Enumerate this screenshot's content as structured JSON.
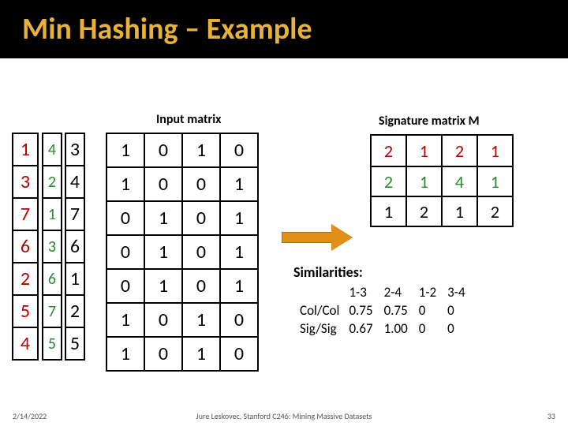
{
  "title": "Min Hashing – Example",
  "labels": {
    "input": "Input matrix",
    "signature": "Signature matrix M"
  },
  "perm": {
    "col0": [
      "1",
      "3",
      "7",
      "6",
      "2",
      "5",
      "4"
    ],
    "col1": [
      "4",
      "2",
      "1",
      "3",
      "6",
      "7",
      "5"
    ],
    "col2": [
      "3",
      "4",
      "7",
      "6",
      "1",
      "2",
      "5"
    ]
  },
  "input_matrix": [
    [
      "1",
      "0",
      "1",
      "0"
    ],
    [
      "1",
      "0",
      "0",
      "1"
    ],
    [
      "0",
      "1",
      "0",
      "1"
    ],
    [
      "0",
      "1",
      "0",
      "1"
    ],
    [
      "0",
      "1",
      "0",
      "1"
    ],
    [
      "1",
      "0",
      "1",
      "0"
    ],
    [
      "1",
      "0",
      "1",
      "0"
    ]
  ],
  "sig_matrix": [
    [
      "2",
      "1",
      "2",
      "1"
    ],
    [
      "2",
      "1",
      "4",
      "1"
    ],
    [
      "1",
      "2",
      "1",
      "2"
    ]
  ],
  "sim": {
    "title": "Similarities:",
    "hdr": [
      "1-3",
      "2-4",
      "1-2",
      "3-4"
    ],
    "rows": [
      {
        "label": "Col/Col",
        "vals": [
          "0.75",
          "0.75",
          "0",
          "0"
        ]
      },
      {
        "label": "Sig/Sig",
        "vals": [
          "0.67",
          "1.00",
          "0",
          "0"
        ]
      }
    ]
  },
  "footer": {
    "date": "2/14/2022",
    "mid": "Jure Leskovec, Stanford C246: Mining Massive Datasets",
    "page": "33"
  }
}
